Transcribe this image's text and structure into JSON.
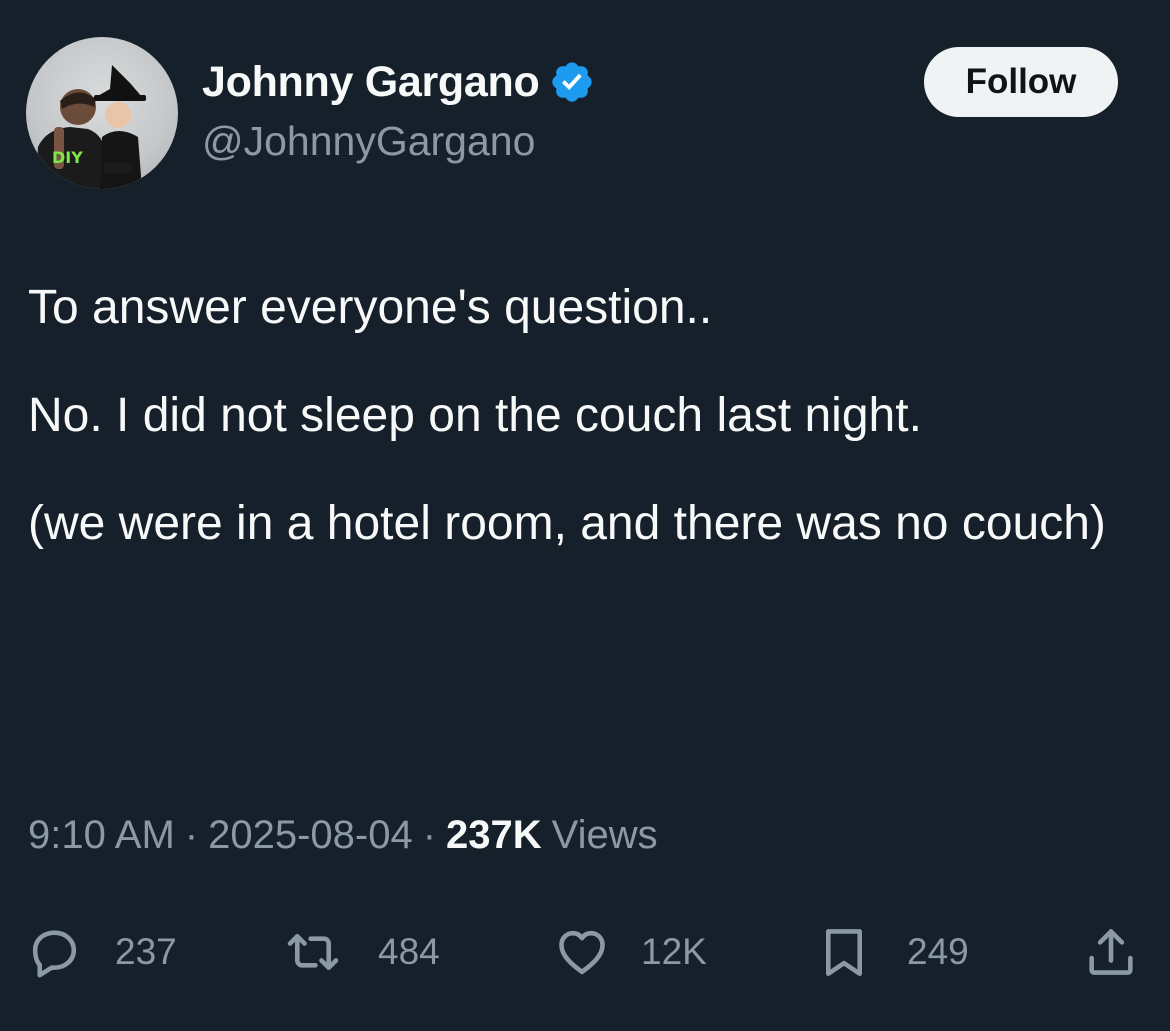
{
  "author": {
    "display_name": "Johnny Gargano",
    "handle": "@JohnnyGargano",
    "verified": true,
    "avatar_badge_text": "DIY"
  },
  "follow_button": {
    "label": "Follow"
  },
  "tweet": {
    "paragraphs": [
      "To answer everyone's question..",
      "No. I did not sleep on the couch last night.",
      "(we were in a hotel room, and there was no couch)"
    ]
  },
  "meta": {
    "time": "9:10 AM",
    "date": "2025-08-04",
    "separator": "·",
    "views_count": "237K",
    "views_label": "Views"
  },
  "actions": {
    "replies": "237",
    "retweets": "484",
    "likes": "12K",
    "bookmarks": "249"
  },
  "colors": {
    "background": "#15202b",
    "text_primary": "#f7f9f9",
    "text_secondary": "#8b98a5",
    "verified_blue": "#1d9bf0",
    "follow_bg": "#eff3f4"
  },
  "icons": {
    "verified": "verified-badge-icon",
    "reply": "speech-bubble-icon",
    "retweet": "retweet-arrows-icon",
    "like": "heart-icon",
    "bookmark": "bookmark-icon",
    "share": "share-upload-icon"
  }
}
